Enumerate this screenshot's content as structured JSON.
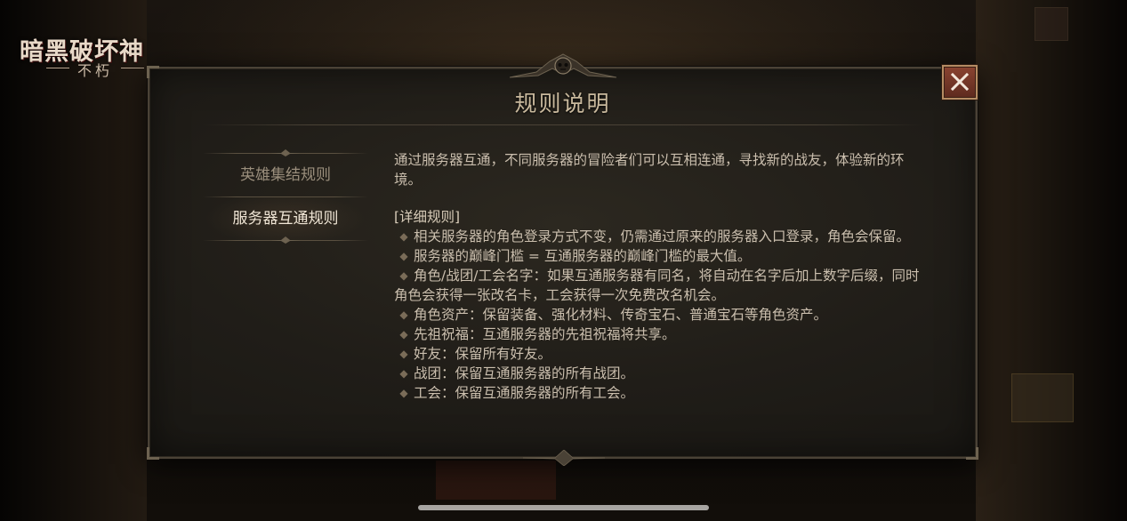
{
  "game": {
    "logo_title": "暗黑破坏神",
    "logo_subtitle": "不朽"
  },
  "dialog": {
    "title": "规则说明",
    "close_icon": "close-icon",
    "tabs": [
      {
        "label": "英雄集结规则",
        "active": false
      },
      {
        "label": "服务器互通规则",
        "active": true
      }
    ],
    "intro": "通过服务器互通，不同服务器的冒险者们可以互相连通，寻找新的战友，体验新的环境。",
    "section_heading": "[详细规则]",
    "rules": [
      "相关服务器的角色登录方式不变，仍需通过原来的服务器入口登录，角色会保留。",
      "服务器的巅峰门槛 = 互通服务器的巅峰门槛的最大值。",
      "角色/战团/工会名字：如果互通服务器有同名，将自动在名字后加上数字后缀，同时角色会获得一张改名卡，工会获得一次免费改名机会。",
      "角色资产：保留装备、强化材料、传奇宝石、普通宝石等角色资产。",
      "先祖祝福：互通服务器的先祖祝福将共享。",
      "好友：保留所有好友。",
      "战团：保留互通服务器的所有战团。",
      "工会：保留互通服务器的所有工会。"
    ],
    "bullet_icon": "diamond-bullet-icon"
  },
  "colors": {
    "accent_text": "#c9b99d",
    "active_tab": "#f0e6d6",
    "close_button": "#7a3a2a"
  }
}
